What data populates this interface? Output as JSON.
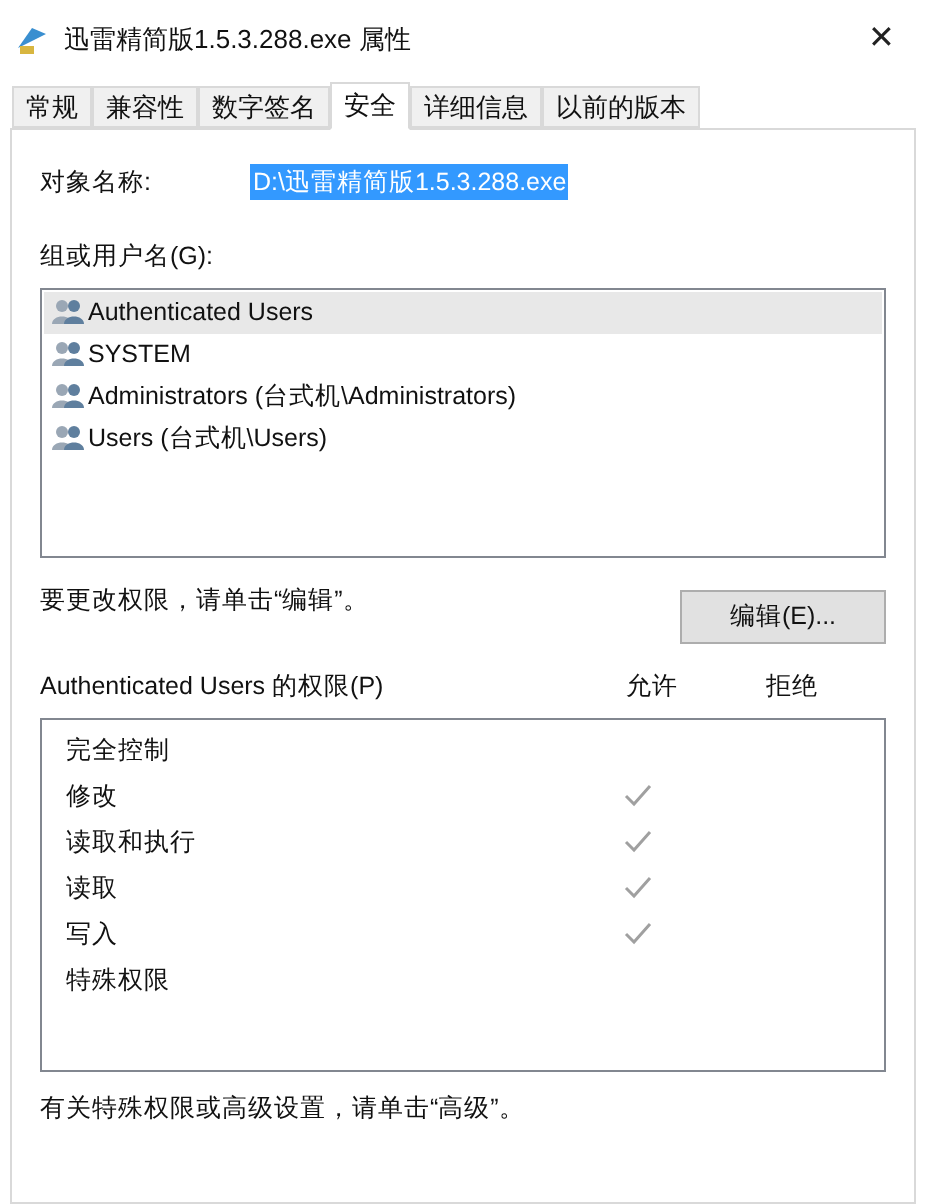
{
  "window": {
    "title": "迅雷精简版1.5.3.288.exe 属性",
    "close": "✕"
  },
  "tabs": [
    {
      "label": "常规",
      "selected": false
    },
    {
      "label": "兼容性",
      "selected": false
    },
    {
      "label": "数字签名",
      "selected": false
    },
    {
      "label": "安全",
      "selected": true
    },
    {
      "label": "详细信息",
      "selected": false
    },
    {
      "label": "以前的版本",
      "selected": false
    }
  ],
  "object_name": {
    "label": "对象名称:",
    "value": "D:\\迅雷精简版1.5.3.288.exe"
  },
  "groups": {
    "label": "组或用户名(G):",
    "items": [
      {
        "name": "Authenticated Users",
        "selected": true
      },
      {
        "name": "SYSTEM",
        "selected": false
      },
      {
        "name": "Administrators (台式机\\Administrators)",
        "selected": false
      },
      {
        "name": "Users (台式机\\Users)",
        "selected": false
      }
    ]
  },
  "edit_hint": "要更改权限，请单击“编辑”。",
  "edit_button": "编辑(E)...",
  "permissions": {
    "label": "Authenticated Users 的权限(P)",
    "allow_header": "允许",
    "deny_header": "拒绝",
    "rows": [
      {
        "name": "完全控制",
        "allow": false
      },
      {
        "name": "修改",
        "allow": true
      },
      {
        "name": "读取和执行",
        "allow": true
      },
      {
        "name": "读取",
        "allow": true
      },
      {
        "name": "写入",
        "allow": true
      },
      {
        "name": "特殊权限",
        "allow": false
      }
    ]
  },
  "advanced_hint": "有关特殊权限或高级设置，请单击“高级”。"
}
